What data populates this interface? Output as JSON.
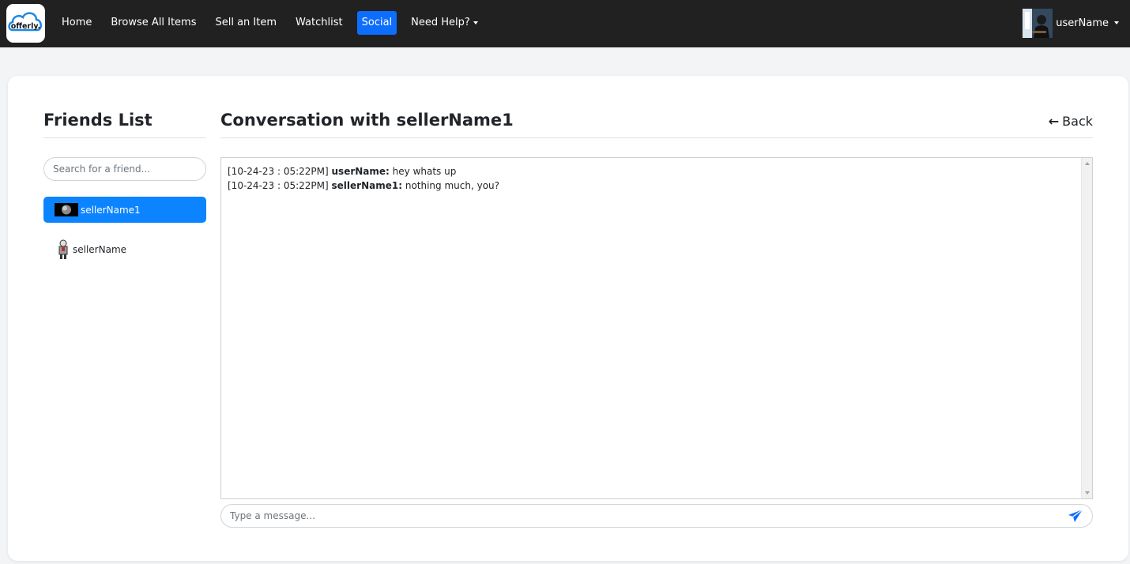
{
  "app": {
    "logo_text": "offerly."
  },
  "nav": {
    "items": [
      {
        "label": "Home"
      },
      {
        "label": "Browse All Items"
      },
      {
        "label": "Sell an Item"
      },
      {
        "label": "Watchlist"
      },
      {
        "label": "Social",
        "active": true
      },
      {
        "label": "Need Help?",
        "dropdown": true
      }
    ],
    "user": {
      "name": "userName"
    }
  },
  "friends": {
    "title": "Friends List",
    "search_placeholder": "Search for a friend...",
    "items": [
      {
        "name": "sellerName1",
        "active": true
      },
      {
        "name": "sellerName",
        "active": false
      }
    ]
  },
  "conversation": {
    "title": "Conversation with sellerName1",
    "back_label": "Back",
    "messages": [
      {
        "timestamp": "[10-24-23 : 05:22PM]",
        "sender": "userName:",
        "text": "hey whats up"
      },
      {
        "timestamp": "[10-24-23 : 05:22PM]",
        "sender": "sellerName1:",
        "text": "nothing much, you?"
      }
    ],
    "input_placeholder": "Type a message..."
  },
  "colors": {
    "navbar_bg": "#212121",
    "accent": "#0d6efd",
    "friend_active_bg": "#0d84ff",
    "send_icon": "#0d6efd"
  },
  "icons": {
    "back": "arrow-left-icon",
    "send": "paper-plane-icon",
    "dropdown": "caret-down-icon"
  }
}
